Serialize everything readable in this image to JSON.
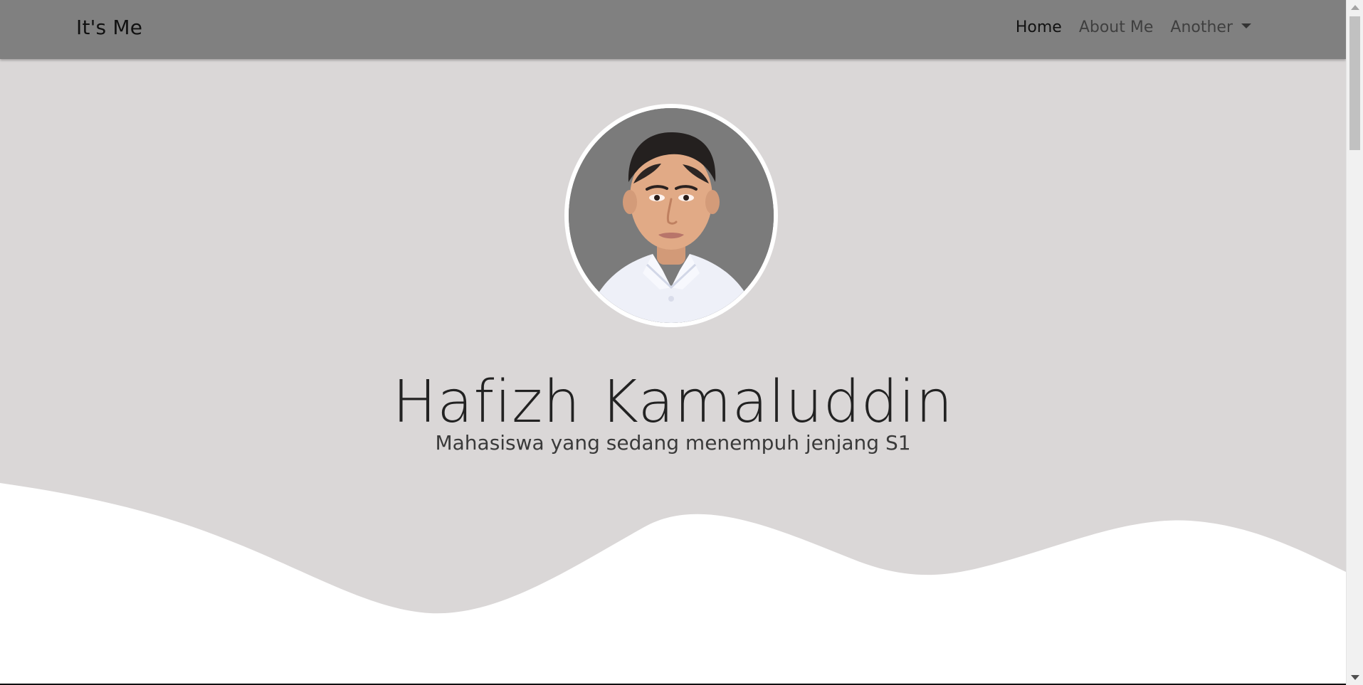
{
  "navbar": {
    "brand": "It's Me",
    "links": [
      {
        "label": "Home",
        "active": true
      },
      {
        "label": "About Me",
        "active": false
      },
      {
        "label": "Another",
        "active": false,
        "dropdown": true
      }
    ],
    "background": "#808080"
  },
  "hero": {
    "name": "Hafizh Kamaluddin",
    "tagline": "Mahasiswa yang sedang menempuh jenjang S1",
    "background": "#dad7d7",
    "avatar_icon": "profile-photo"
  },
  "colors": {
    "accent": "#111111",
    "page": "#ffffff"
  }
}
